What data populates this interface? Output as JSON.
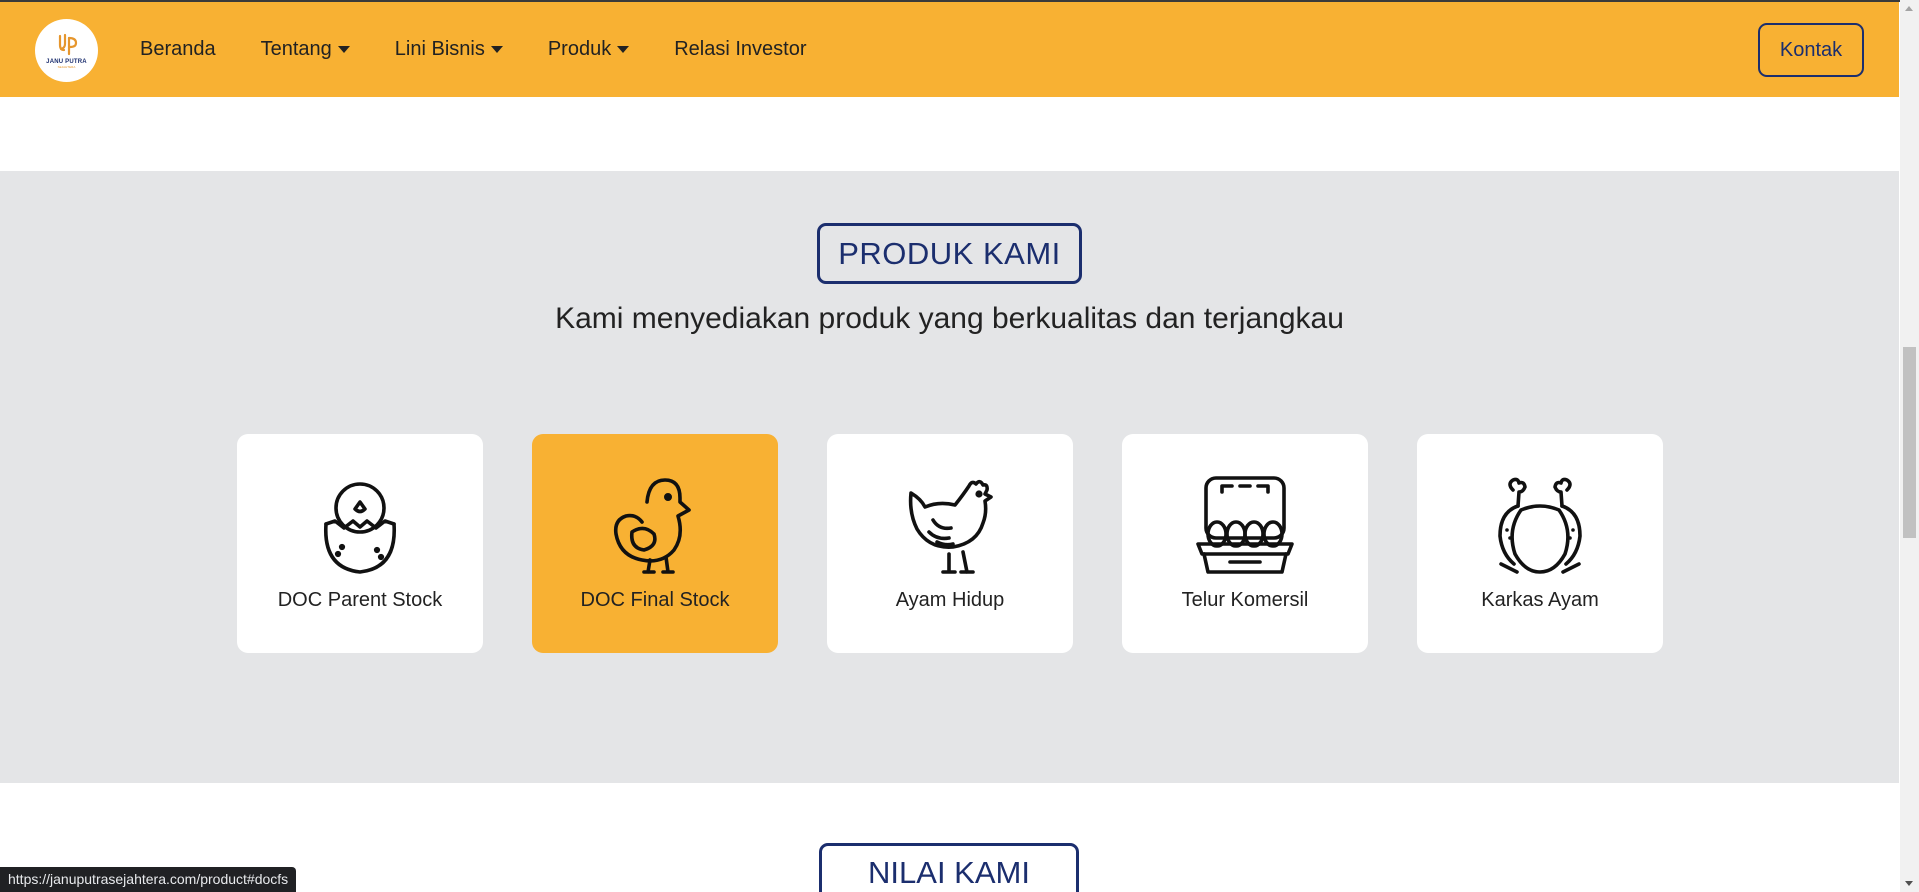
{
  "navbar": {
    "logo": {
      "name": "JANU PUTRA",
      "subtitle": "SEJAHTERA"
    },
    "menu": [
      {
        "label": "Beranda",
        "dropdown": false
      },
      {
        "label": "Tentang",
        "dropdown": true
      },
      {
        "label": "Lini Bisnis",
        "dropdown": true
      },
      {
        "label": "Produk",
        "dropdown": true
      },
      {
        "label": "Relasi Investor",
        "dropdown": false
      }
    ],
    "contact_label": "Kontak",
    "background_color": "#f8b133"
  },
  "products_section": {
    "badge": "PRODUK KAMI",
    "subtitle": "Kami menyediakan produk yang berkualitas dan terjangkau",
    "background_color": "#e4e5e7",
    "products": [
      {
        "label": "DOC Parent Stock",
        "icon": "hatching-chick-icon",
        "active": false
      },
      {
        "label": "DOC Final Stock",
        "icon": "chick-icon",
        "active": true
      },
      {
        "label": "Ayam Hidup",
        "icon": "hen-icon",
        "active": false
      },
      {
        "label": "Telur Komersil",
        "icon": "egg-carton-icon",
        "active": false
      },
      {
        "label": "Karkas Ayam",
        "icon": "roast-chicken-icon",
        "active": false
      }
    ],
    "active_color": "#f8b133"
  },
  "values_section": {
    "badge": "NILAI KAMI"
  },
  "accent_color": "#1b2e6e",
  "status_bar": {
    "url": "https://januputrasejahtera.com/product#docfs"
  }
}
